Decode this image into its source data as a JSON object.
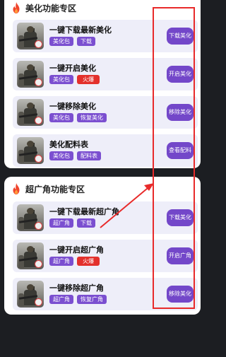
{
  "sections": [
    {
      "title": "美化功能专区",
      "items": [
        {
          "title": "一键下载最新美化",
          "tags": [
            "美化包",
            "下载"
          ],
          "button": "下载美化"
        },
        {
          "title": "一键开启美化",
          "tags": [
            "美化包",
            "火爆"
          ],
          "button": "开启美化"
        },
        {
          "title": "一键移除美化",
          "tags": [
            "美化包",
            "恢复美化"
          ],
          "button": "移除美化"
        },
        {
          "title": "美化配料表",
          "tags": [
            "美化包",
            "配料表"
          ],
          "button": "查看配料"
        }
      ]
    },
    {
      "title": "超广角功能专区",
      "items": [
        {
          "title": "一键下载最新超广角",
          "tags": [
            "超广角",
            "下载"
          ],
          "button": "下载美化"
        },
        {
          "title": "一键开启超广角",
          "tags": [
            "超广角",
            "火爆"
          ],
          "button": "开启广角"
        },
        {
          "title": "一键移除超广角",
          "tags": [
            "超广角",
            "恢复广角"
          ],
          "button": "移除美化"
        }
      ]
    }
  ],
  "icons": {
    "section": "flame-icon",
    "thumbnail": "game-thumbnail-icon"
  },
  "colors": {
    "accent": "#7347c9",
    "tag": "#7b4fd0",
    "hot_tag": "#e3302c",
    "annotation": "#e82a2a",
    "row_bg": "#eeeef9"
  }
}
